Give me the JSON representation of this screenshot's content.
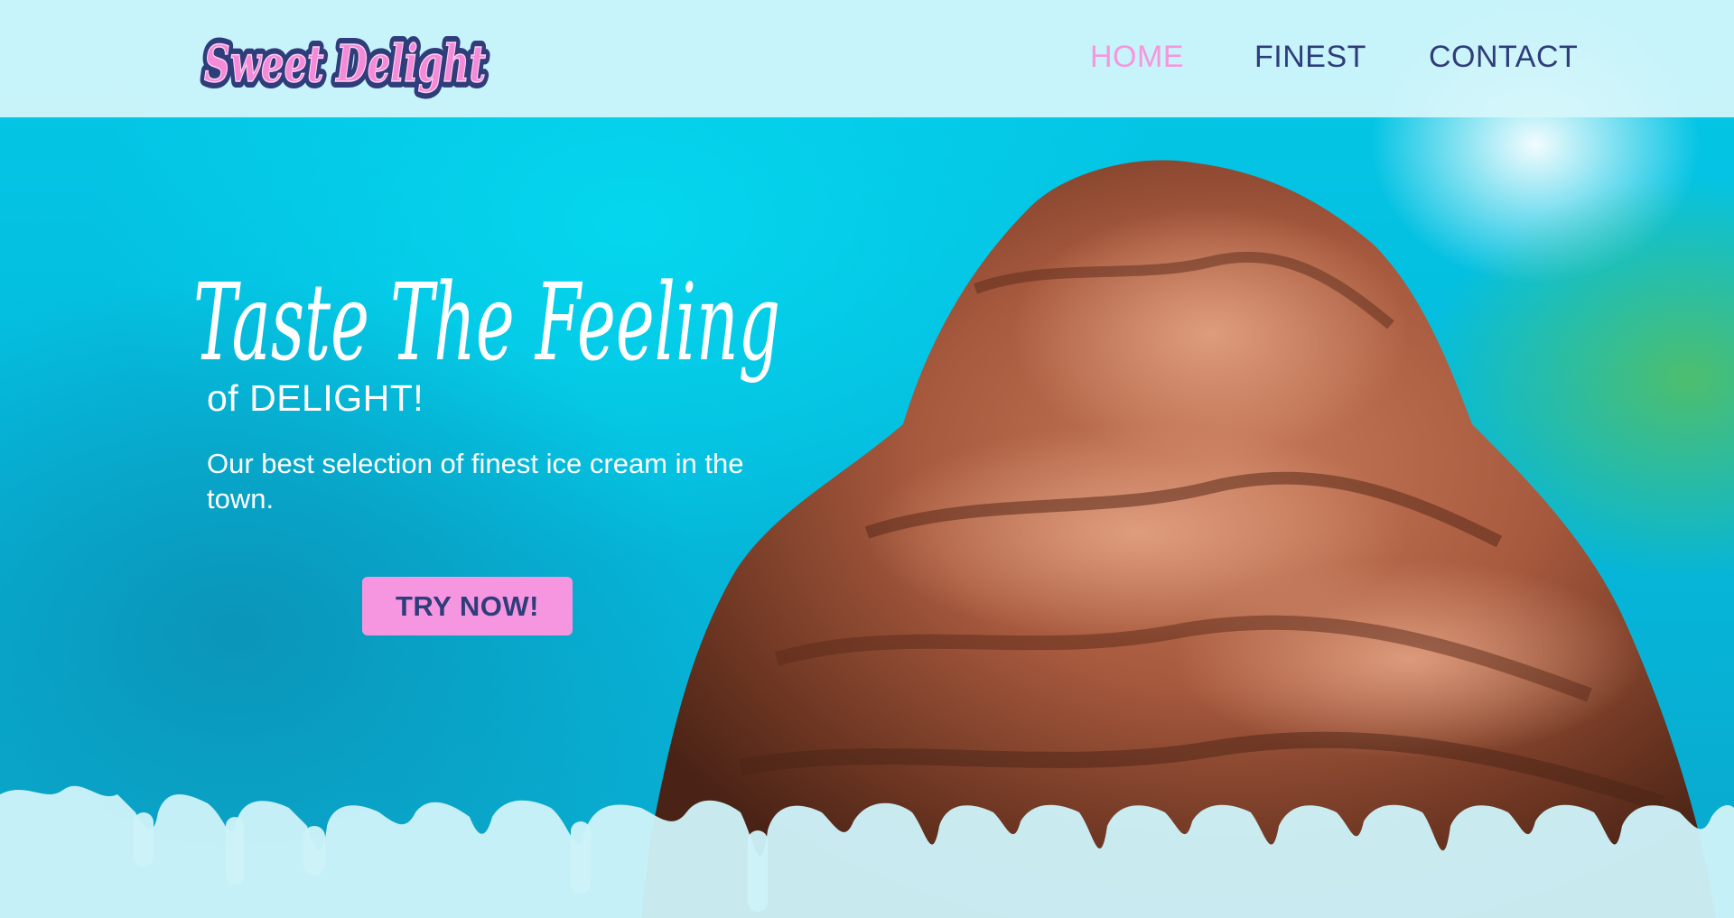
{
  "brand": {
    "logo_text": "Sweet Delight",
    "logo_fill": "#f58ad8",
    "logo_outline": "#2f3d7a"
  },
  "nav": {
    "items": [
      {
        "label": "HOME",
        "active": true
      },
      {
        "label": "FINEST",
        "active": false
      },
      {
        "label": "CONTACT",
        "active": false
      }
    ]
  },
  "hero": {
    "headline": "Taste The Feeling",
    "subheadline": "of DELIGHT!",
    "description": "Our best selection of finest ice cream in the town.",
    "cta_label": "TRY NOW!"
  },
  "colors": {
    "accent_pink": "#f796e0",
    "navy": "#2f3d7a",
    "hero_blue": "#06c3e3",
    "header_bg": "#d6f6fb"
  },
  "icons": {
    "hero_image": "chocolate-ice-cream-scoop",
    "drips": "melting-drips-decoration"
  }
}
